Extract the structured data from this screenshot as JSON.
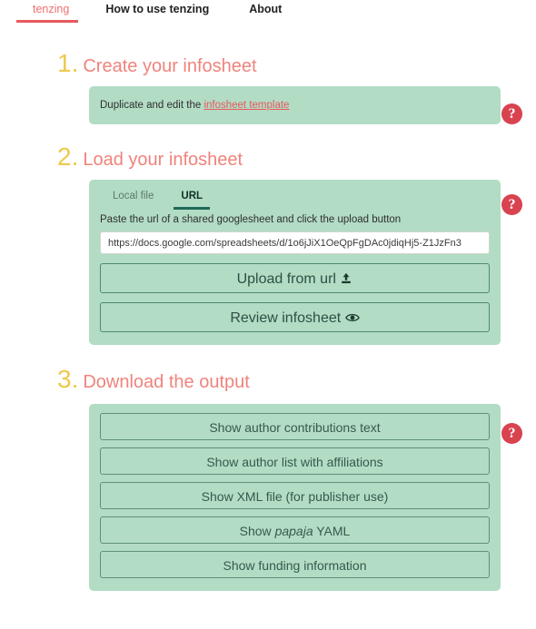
{
  "nav": {
    "brand": "tenzing",
    "items": [
      {
        "label": "How to use tenzing"
      },
      {
        "label": "About"
      }
    ]
  },
  "help": {
    "glyph": "?"
  },
  "sections": [
    {
      "number": "1.",
      "title": "Create your infosheet",
      "body": {
        "text_before": "Duplicate and edit the ",
        "link_label": "infosheet template"
      }
    },
    {
      "number": "2.",
      "title": "Load your infosheet",
      "tabs": [
        {
          "label": "Local file",
          "active": false
        },
        {
          "label": "URL",
          "active": true
        }
      ],
      "hint": "Paste the url of a shared googlesheet and click the upload button",
      "url_value": "https://docs.google.com/spreadsheets/d/1o6jJiX1OeQpFgDAc0jdiqHj5-Z1JzFn3",
      "url_placeholder": "",
      "buttons": [
        {
          "label": "Upload from url",
          "icon": "upload-icon",
          "glyph": "⬆"
        },
        {
          "label": "Review infosheet",
          "icon": "eye-icon",
          "glyph": "◉"
        }
      ]
    },
    {
      "number": "3.",
      "title": "Download the output",
      "buttons": [
        {
          "label": "Show author contributions text"
        },
        {
          "label": "Show author list with affiliations"
        },
        {
          "label": "Show XML file (for publisher use)"
        },
        {
          "label_pre": "Show ",
          "label_italic": "papaja",
          "label_post": " YAML"
        },
        {
          "label": "Show funding information"
        }
      ]
    }
  ],
  "colors": {
    "brand_pink": "#ef6f72",
    "heading_pink": "#f0837c",
    "number_gold": "#eec94c",
    "panel_green": "#b2dcc4",
    "help_red": "#d8434f",
    "tab_active": "#20695a"
  }
}
